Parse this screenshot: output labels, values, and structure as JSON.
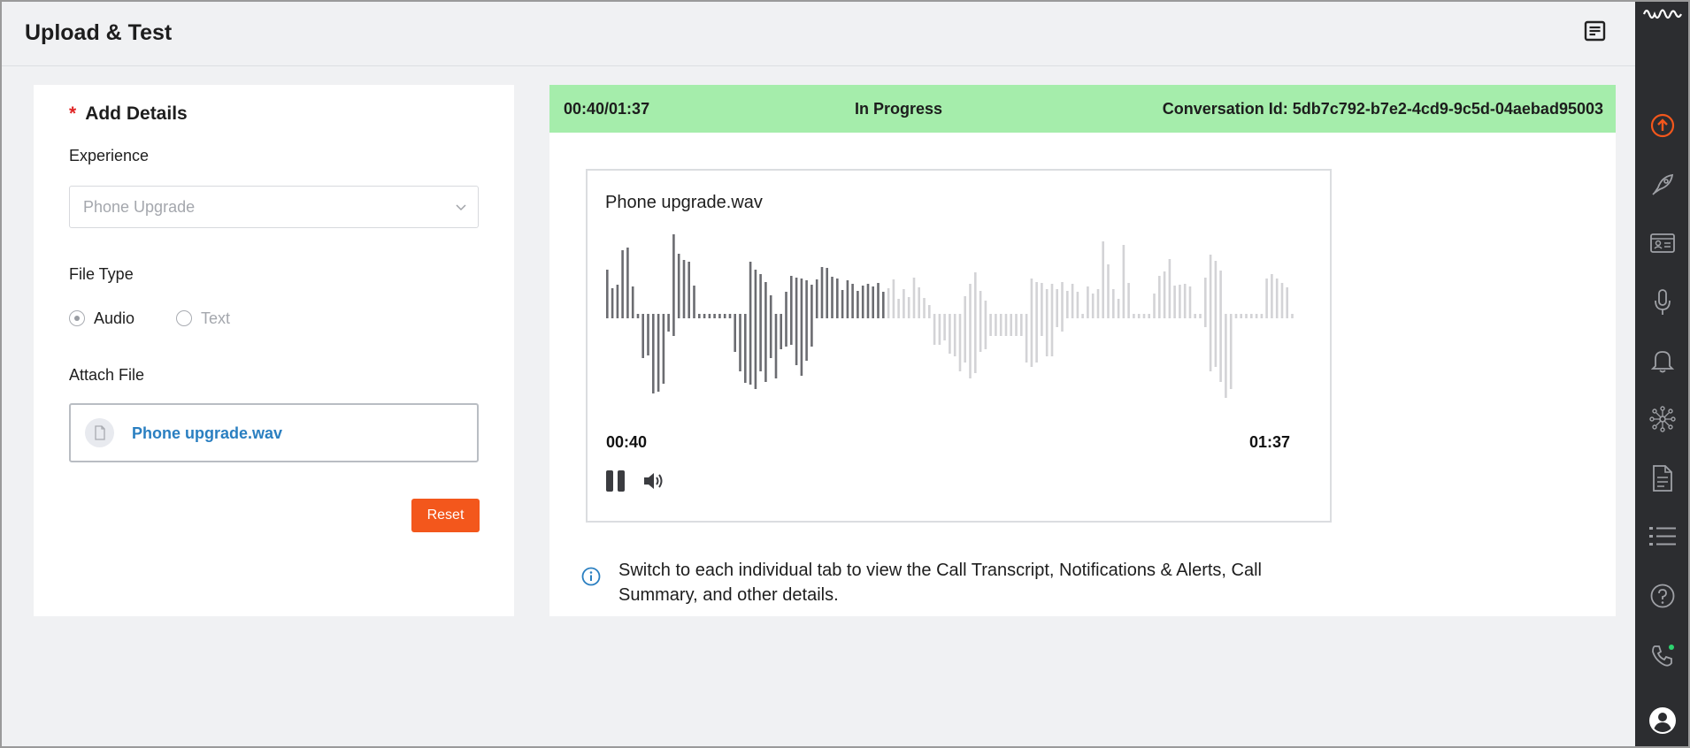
{
  "header": {
    "title": "Upload & Test",
    "notes_icon": "notes-icon"
  },
  "left_panel": {
    "section_title": "Add Details",
    "required_mark": "*",
    "experience": {
      "label": "Experience",
      "value": "Phone Upgrade"
    },
    "file_type": {
      "label": "File Type",
      "options": [
        "Audio",
        "Text"
      ],
      "selected": "Audio"
    },
    "attach": {
      "label": "Attach File",
      "file_name": "Phone upgrade.wav"
    },
    "reset_label": "Reset"
  },
  "right_panel": {
    "status_bar": {
      "elapsed": "00:40/01:37",
      "status": "In Progress",
      "conversation": "Conversation Id: 5db7c792-b7e2-4cd9-9c5d-04aebad95003",
      "color": "#a5edab"
    },
    "player": {
      "title": "Phone upgrade.wav",
      "current_time": "00:40",
      "duration": "01:37",
      "progress": 0.41,
      "played_color": "#6b6c71",
      "unplayed_color": "#d3d3d6"
    },
    "info_text": "Switch to each individual tab to view the Call Transcript, Notifications & Alerts, Call Summary, and other details."
  },
  "sidebar": {
    "icons": [
      "waveform-logo-icon",
      "upload-icon",
      "rocket-icon",
      "contact-card-icon",
      "microphone-icon",
      "bell-icon",
      "network-icon",
      "document-icon",
      "list-icon",
      "help-icon",
      "phone-icon",
      "user-icon"
    ],
    "active": "upload-icon",
    "accent": "#f3571c"
  }
}
